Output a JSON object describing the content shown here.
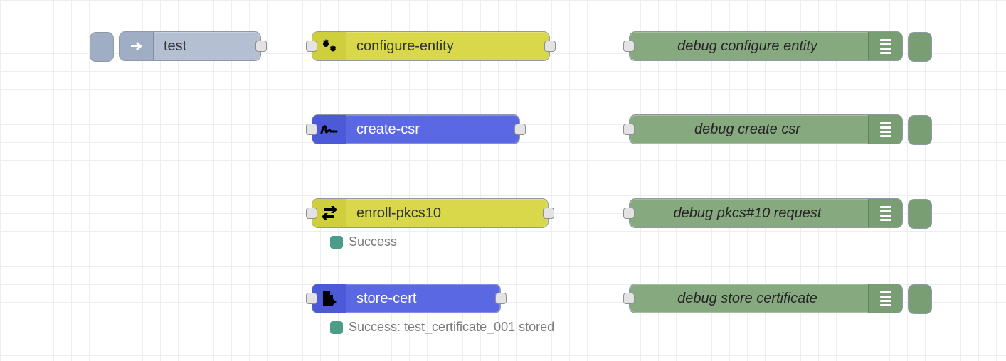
{
  "nodes": {
    "inject": {
      "label": "test"
    },
    "configure": {
      "label": "configure-entity"
    },
    "create_csr": {
      "label": "create-csr"
    },
    "enroll": {
      "label": "enroll-pkcs10"
    },
    "store": {
      "label": "store-cert"
    },
    "dbg_configure": {
      "label": "debug configure entity"
    },
    "dbg_csr": {
      "label": "debug create csr"
    },
    "dbg_pkcs": {
      "label": "debug pkcs#10 request"
    },
    "dbg_store": {
      "label": "debug store certificate"
    }
  },
  "status": {
    "enroll": "Success",
    "store": "Success: test_certificate_001 stored"
  },
  "colors": {
    "wire": "#9e9e9e",
    "status_dot": "#4c9c8a"
  }
}
